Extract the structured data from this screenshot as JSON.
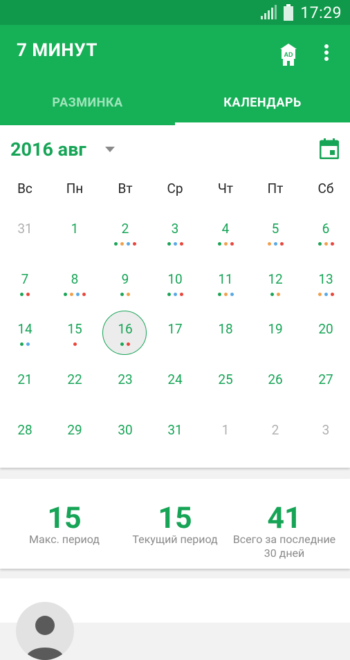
{
  "status_bar": {
    "time": "17:29",
    "icons": [
      "signal-icon",
      "battery-icon"
    ]
  },
  "app_bar": {
    "title": "7 МИНУТ",
    "icons": [
      "ad-icon",
      "more-vert-icon"
    ]
  },
  "tabs": [
    {
      "label": "РАЗМИНКА",
      "active": false
    },
    {
      "label": "КАЛЕНДАРЬ",
      "active": true
    }
  ],
  "calendar": {
    "month_title": "2016 авг",
    "icons": [
      "dropdown-arrow-icon",
      "calendar-icon"
    ],
    "weekdays": [
      "Вс",
      "Пн",
      "Вт",
      "Ср",
      "Чт",
      "Пт",
      "Сб"
    ],
    "days": [
      {
        "label": "31",
        "muted": true,
        "dots": []
      },
      {
        "label": "1",
        "dots": []
      },
      {
        "label": "2",
        "dots": [
          "#1aa556",
          "#f0a04b",
          "#59a9e6",
          "#e8463c"
        ]
      },
      {
        "label": "3",
        "dots": [
          "#1aa556",
          "#59a9e6",
          "#e8463c"
        ]
      },
      {
        "label": "4",
        "dots": [
          "#1aa556",
          "#f0a04b",
          "#e8463c"
        ]
      },
      {
        "label": "5",
        "dots": [
          "#f0a04b",
          "#59a9e6",
          "#e8463c"
        ]
      },
      {
        "label": "6",
        "dots": [
          "#1aa556",
          "#f0a04b",
          "#e8463c"
        ]
      },
      {
        "label": "7",
        "dots": [
          "#1aa556",
          "#e8463c"
        ]
      },
      {
        "label": "8",
        "dots": [
          "#1aa556",
          "#f0a04b",
          "#59a9e6",
          "#e8463c"
        ]
      },
      {
        "label": "9",
        "dots": [
          "#1aa556",
          "#f0a04b"
        ]
      },
      {
        "label": "10",
        "dots": [
          "#1aa556",
          "#59a9e6",
          "#e8463c"
        ]
      },
      {
        "label": "11",
        "dots": [
          "#1aa556",
          "#f0a04b",
          "#59a9e6"
        ]
      },
      {
        "label": "12",
        "dots": [
          "#1aa556",
          "#f0a04b"
        ]
      },
      {
        "label": "13",
        "dots": [
          "#f0a04b",
          "#59a9e6",
          "#e8463c"
        ]
      },
      {
        "label": "14",
        "dots": [
          "#1aa556",
          "#59a9e6"
        ]
      },
      {
        "label": "15",
        "dots": [
          "#e8463c"
        ]
      },
      {
        "label": "16",
        "today": true,
        "dots": [
          "#1aa556",
          "#e8463c"
        ]
      },
      {
        "label": "17",
        "dots": []
      },
      {
        "label": "18",
        "dots": []
      },
      {
        "label": "19",
        "dots": []
      },
      {
        "label": "20",
        "dots": []
      },
      {
        "label": "21",
        "dots": []
      },
      {
        "label": "22",
        "dots": []
      },
      {
        "label": "23",
        "dots": []
      },
      {
        "label": "24",
        "dots": []
      },
      {
        "label": "25",
        "dots": []
      },
      {
        "label": "26",
        "dots": []
      },
      {
        "label": "27",
        "dots": []
      },
      {
        "label": "28",
        "dots": []
      },
      {
        "label": "29",
        "dots": []
      },
      {
        "label": "30",
        "dots": []
      },
      {
        "label": "31",
        "dots": []
      },
      {
        "label": "1",
        "muted": true,
        "dots": []
      },
      {
        "label": "2",
        "muted": true,
        "dots": []
      },
      {
        "label": "3",
        "muted": true,
        "dots": []
      }
    ]
  },
  "stats": [
    {
      "value": "15",
      "label": "Макс. период"
    },
    {
      "value": "15",
      "label": "Текущий период"
    },
    {
      "value": "41",
      "label": "Всего за последние 30 дней"
    }
  ],
  "profile": {
    "icons": [
      "avatar-icon"
    ]
  },
  "colors": {
    "primary": "#16b057",
    "primary_dark": "#10994a",
    "accent_text": "#16a456",
    "inactive_tab": "#9fe6bb",
    "muted_day": "#b0b0b0",
    "dot_green": "#1aa556",
    "dot_orange": "#f0a04b",
    "dot_blue": "#59a9e6",
    "dot_red": "#e8463c"
  }
}
